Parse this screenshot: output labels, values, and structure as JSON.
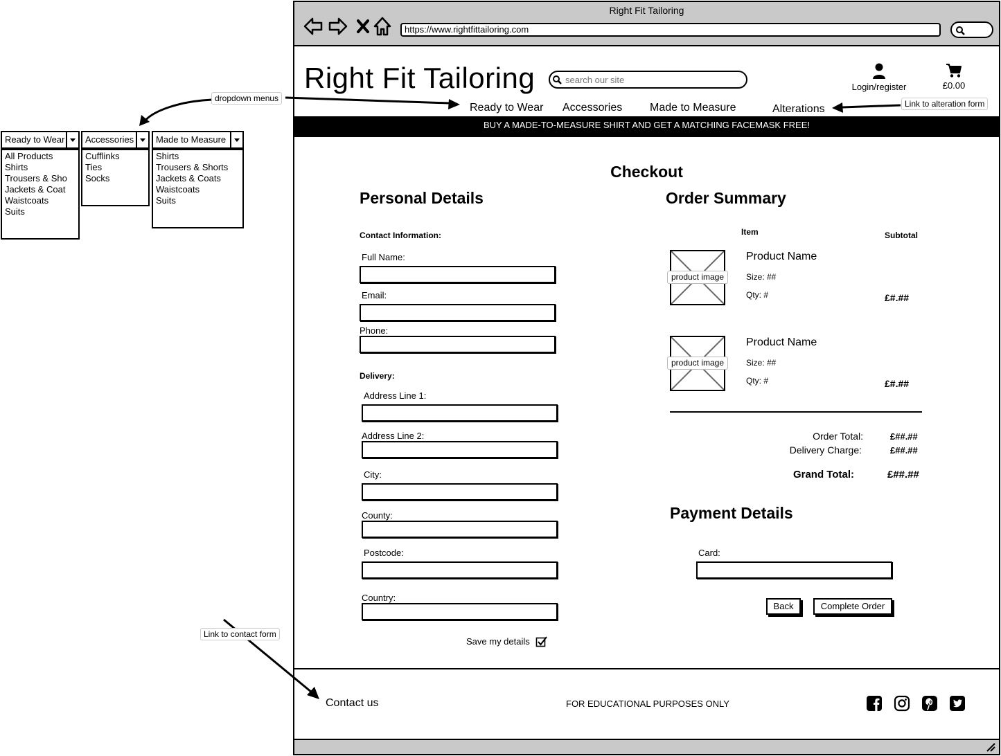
{
  "browser": {
    "title": "Right Fit Tailoring",
    "url": "https://www.rightfittailoring.com"
  },
  "header": {
    "logo": "Right Fit Tailoring",
    "search_placeholder": "search our site",
    "login_label": "Login/register",
    "cart_total": "£0.00"
  },
  "nav": {
    "ready_to_wear": "Ready to Wear",
    "accessories": "Accessories",
    "made_to_measure": "Made to Measure",
    "alterations": "Alterations"
  },
  "banner": "BUY A MADE-TO-MEASURE SHIRT AND GET A MATCHING FACEMASK FREE!",
  "checkout": {
    "title": "Checkout",
    "personal_heading": "Personal Details",
    "contact_heading": "Contact Information:",
    "full_name_label": "Full Name:",
    "email_label": "Email:",
    "phone_label": "Phone:",
    "delivery_heading": "Delivery:",
    "address1_label": "Address Line 1:",
    "address2_label": "Address Line 2:",
    "city_label": "City:",
    "county_label": "County:",
    "postcode_label": "Postcode:",
    "country_label": "Country:",
    "save_details_label": "Save my details",
    "save_details_checked": true
  },
  "order_summary": {
    "heading": "Order Summary",
    "col_item": "Item",
    "col_subtotal": "Subtotal",
    "items": [
      {
        "image_label": "product image",
        "name": "Product Name",
        "size": "Size: ##",
        "qty": "Qty: #",
        "subtotal": "£#.##"
      },
      {
        "image_label": "product image",
        "name": "Product Name",
        "size": "Size: ##",
        "qty": "Qty: #",
        "subtotal": "£#.##"
      }
    ],
    "order_total_label": "Order Total:",
    "order_total": "£##.##",
    "delivery_label": "Delivery Charge:",
    "delivery": "£##.##",
    "grand_total_label": "Grand Total:",
    "grand_total": "£##.##"
  },
  "payment": {
    "heading": "Payment Details",
    "card_label": "Card:",
    "back_button": "Back",
    "complete_button": "Complete Order"
  },
  "footer": {
    "contact": "Contact us",
    "notice": "FOR EDUCATIONAL PURPOSES ONLY",
    "social_icons": [
      "facebook-icon",
      "instagram-icon",
      "pinterest-icon",
      "twitter-icon"
    ]
  },
  "dropdowns": {
    "ready_to_wear": {
      "label": "Ready to Wear",
      "items": [
        "All Products",
        "Shirts",
        "Trousers & Sho",
        "Jackets & Coat",
        "Waistcoats",
        "Suits"
      ]
    },
    "accessories": {
      "label": "Accessories",
      "items": [
        "Cufflinks",
        "Ties",
        "Socks"
      ]
    },
    "made_to_measure": {
      "label": "Made to Measure",
      "items": [
        "Shirts",
        "Trousers & Shorts",
        "Jackets & Coats",
        "Waistcoats",
        "Suits"
      ]
    }
  },
  "annotations": {
    "dropdown_menus": "dropdown menus",
    "alteration_link": "Link to alteration form",
    "contact_link": "Link to contact form"
  }
}
